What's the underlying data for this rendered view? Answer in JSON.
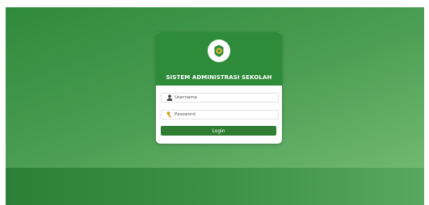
{
  "login": {
    "title": "SISTEM ADMINISTRASI SEKOLAH",
    "username_placeholder": "Username",
    "password_placeholder": "Password",
    "login_label": "Login"
  },
  "icons": {
    "logo": "school-emblem-icon",
    "username": "user-icon",
    "password": "key-icon"
  },
  "colors": {
    "primary": "#2e8b3a",
    "button": "#2e7d32",
    "background_start": "#2f8a3c",
    "background_end": "#79bf78"
  }
}
